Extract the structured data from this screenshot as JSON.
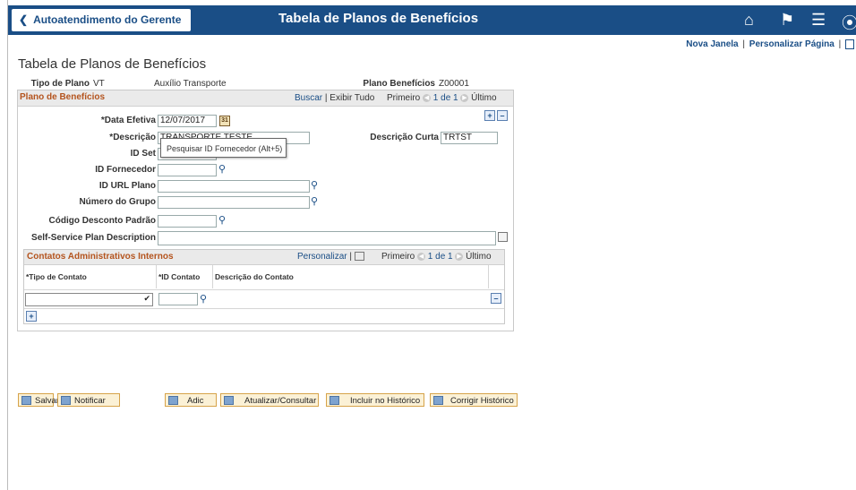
{
  "header": {
    "back_label": "Autoatendimento do Gerente",
    "app_title": "Tabela de Planos de Benefícios",
    "links": {
      "new_window": "Nova Janela",
      "personalize": "Personalizar Página",
      "sep": "|"
    }
  },
  "page": {
    "title": "Tabela de Planos de Benefícios",
    "plan_type_label": "Tipo de Plano",
    "plan_type_code": "VT",
    "plan_type_desc": "Auxílio Transporte",
    "benefit_plan_label": "Plano Benefícios",
    "benefit_plan_value": "Z00001"
  },
  "panel": {
    "title": "Plano de Benefícios",
    "find": "Buscar",
    "view_all": "Exibir Tudo",
    "sep": "|",
    "first": "Primeiro",
    "range": "1 de 1",
    "last": "Último"
  },
  "form": {
    "effdt_label": "*Data Efetiva",
    "effdt_value": "12/07/2017",
    "descr_label": "*Descrição",
    "descr_value": "TRANSPORTE TESTE",
    "short_label": "Descrição Curta",
    "short_value": "TRTST",
    "setid_label": "ID Set",
    "vendor_label": "ID Fornecedor",
    "url_label": "ID URL Plano",
    "group_label": "Número do Grupo",
    "deduction_label": "Código Desconto Padrão",
    "ss_label": "Self-Service Plan Description",
    "tooltip": "Pesquisar ID Fornecedor (Alt+5)"
  },
  "grid": {
    "title": "Contatos Administrativos Internos",
    "personalize": "Personalizar",
    "sep": "|",
    "first": "Primeiro",
    "range": "1 de 1",
    "last": "Último",
    "columns": [
      "*Tipo de Contato",
      "*ID Contato",
      "Descrição do Contato"
    ]
  },
  "buttons": {
    "save": "Salvar",
    "notify": "Notificar",
    "add": "Adic",
    "update": "Atualizar/Consultar",
    "include": "Incluir no Histórico",
    "correct": "Corrigir Histórico"
  },
  "icons": {
    "calendar": "calendar-icon",
    "search": "search-icon"
  }
}
